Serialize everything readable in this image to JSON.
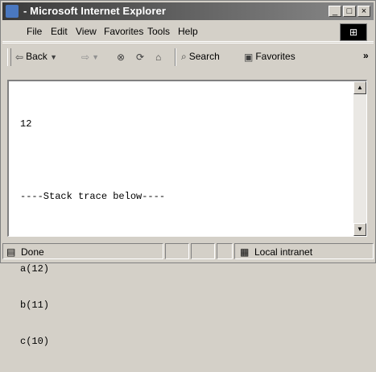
{
  "window": {
    "title": "- Microsoft Internet Explorer"
  },
  "menu": {
    "items": [
      "File",
      "Edit",
      "View",
      "Favorites",
      "Tools",
      "Help"
    ]
  },
  "toolbar": {
    "back_label": "Back",
    "search_label": "Search",
    "favorites_label": "Favorites",
    "more_label": "»"
  },
  "page": {
    "lines": [
      "12",
      "",
      "----Stack trace below----",
      "",
      "a(12)",
      "b(11)",
      "c(10)"
    ]
  },
  "status": {
    "left_text": "Done",
    "zone_text": "Local intranet"
  },
  "colors": {
    "titlebar": "#3a3a3a",
    "chrome": "#d4d0c8",
    "content_bg": "#ffffff"
  },
  "icons": [
    "ie-window-icon",
    "windows-logo-icon",
    "back-arrow-icon",
    "forward-arrow-icon",
    "stop-icon",
    "refresh-icon",
    "home-icon",
    "search-icon",
    "favorites-icon",
    "done-page-icon",
    "local-intranet-icon"
  ]
}
